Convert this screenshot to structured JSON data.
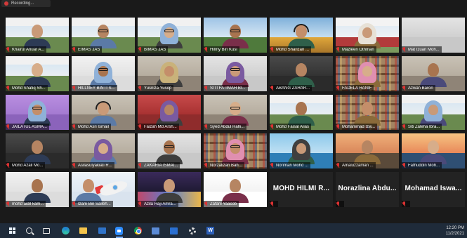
{
  "recording": {
    "label": "Recording..."
  },
  "colors": {
    "speaking": "#e7d64a",
    "muted": "#dd3333"
  },
  "participants": [
    {
      "name": "Khairul Anuar A...",
      "style": "banner",
      "person": "man"
    },
    {
      "name": "EIMAS JAS",
      "style": "banner",
      "person": "man-glasses",
      "speaking": true
    },
    {
      "name": "BIMAS JAS",
      "style": "banner",
      "person": "hijab-glasses"
    },
    {
      "name": "Hilmy Bin Kusi",
      "style": "park",
      "person": "man-glasses"
    },
    {
      "name": "Mohd Sharizan ...",
      "style": "field",
      "person": "man-headset"
    },
    {
      "name": "Mazleen Othman",
      "style": "banner-red",
      "person": "hijab"
    },
    {
      "name": "Mat Izuan Moh...",
      "style": "plain-light",
      "person": "none"
    },
    {
      "name": "Mohd Shafiq Sh...",
      "style": "banner",
      "person": "man"
    },
    {
      "name": "HILLNEY BINTI S...",
      "style": "plain-white",
      "person": "hijab-glasses"
    },
    {
      "name": "Yusniza Yusop",
      "style": "room",
      "person": "hijab"
    },
    {
      "name": "SITI FATIMAH BI...",
      "style": "plain-light",
      "person": "hijab-glasses"
    },
    {
      "name": "ABANG ZAHAR...",
      "style": "dark",
      "person": "man"
    },
    {
      "name": "FADELA HANIF",
      "style": "shelf",
      "person": "hijab"
    },
    {
      "name": "Azwan Baron",
      "style": "room",
      "person": "man"
    },
    {
      "name": "JAILATUL ASMA...",
      "style": "purple",
      "person": "hijab-glasses"
    },
    {
      "name": "Mohd Asri Ismail",
      "style": "room",
      "person": "man-headset"
    },
    {
      "name": "Faizah Md Arsh...",
      "style": "red-wall",
      "person": "hijab"
    },
    {
      "name": "Syed Abdul Rahi...",
      "style": "room",
      "person": "man-glasses"
    },
    {
      "name": "Mohd Faisal Alias",
      "style": "banner",
      "person": "man"
    },
    {
      "name": "Mohammad Izw...",
      "style": "shelf",
      "person": "man"
    },
    {
      "name": "Siti Zaleha Ibra...",
      "style": "banner",
      "person": "hijab"
    },
    {
      "name": "Mohd Azali Mo...",
      "style": "dark",
      "person": "man"
    },
    {
      "name": "Asilasulyakiati R...",
      "style": "room",
      "person": "hijab"
    },
    {
      "name": "ZAKARIA ISMAI...",
      "style": "plain-light",
      "person": "man-glasses"
    },
    {
      "name": "Norzalizah Bah...",
      "style": "shelf",
      "person": "hijab-glasses"
    },
    {
      "name": "Norimah Mohd ...",
      "style": "sea",
      "person": "hijab"
    },
    {
      "name": "Amaluzzaman ...",
      "style": "sunset",
      "person": "man"
    },
    {
      "name": "Fathuddin Moh...",
      "style": "bridge",
      "person": "man"
    },
    {
      "name": "mohd aidil kam...",
      "style": "plain-white",
      "person": "man"
    },
    {
      "name": "Izam Bin Salleh...",
      "style": "rocket",
      "person": "man"
    },
    {
      "name": "Azila Haji Amra...",
      "style": "night",
      "person": "man"
    },
    {
      "name": "Zafani Yaacob",
      "style": "portrait",
      "person": "man"
    },
    {
      "name": "MOHD HILMI R...",
      "style": "text",
      "person": "none"
    },
    {
      "name": "Norazlina Abdu...",
      "style": "text",
      "person": "none"
    },
    {
      "name": "Mohamad Iswa...",
      "style": "text",
      "person": "none"
    }
  ],
  "taskbar": {
    "apps": [
      "windows-start",
      "search",
      "task-view",
      "edge",
      "file-explorer",
      "mail",
      "zoom",
      "chrome",
      "photos",
      "store",
      "settings",
      "word"
    ],
    "time": "12:20 PM",
    "date": "11/2/2021"
  }
}
